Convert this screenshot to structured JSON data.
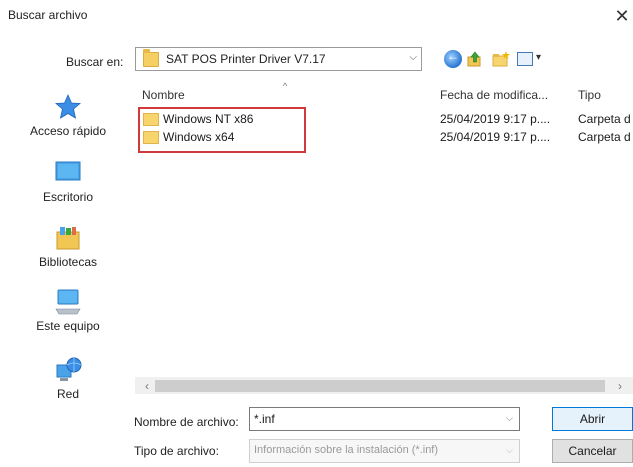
{
  "window": {
    "title": "Buscar archivo",
    "close_glyph": "✕"
  },
  "lookin": {
    "label": "Buscar en:",
    "value": "SAT POS Printer Driver V7.17"
  },
  "sidebar": {
    "items": [
      {
        "label": "Acceso rápido",
        "icon": "star-icon"
      },
      {
        "label": "Escritorio",
        "icon": "desktop-icon"
      },
      {
        "label": "Bibliotecas",
        "icon": "libraries-icon"
      },
      {
        "label": "Este equipo",
        "icon": "computer-icon"
      },
      {
        "label": "Red",
        "icon": "network-icon"
      }
    ]
  },
  "list": {
    "columns": [
      "Nombre",
      "Fecha de modifica...",
      "Tipo"
    ],
    "rows": [
      {
        "name": "Windows NT x86",
        "date": "25/04/2019 9:17 p....",
        "type": "Carpeta d"
      },
      {
        "name": "Windows x64",
        "date": "25/04/2019 9:17 p....",
        "type": "Carpeta d"
      }
    ]
  },
  "footer": {
    "filename_label": "Nombre de archivo:",
    "filename_value": "*.inf",
    "filetype_label": "Tipo de archivo:",
    "filetype_value": "Información sobre la instalación (*.inf)",
    "open_label": "Abrir",
    "cancel_label": "Cancelar"
  },
  "colors": {
    "highlight": "#d03a3a",
    "folder": "#f7d56c",
    "accent": "#0078d7"
  }
}
